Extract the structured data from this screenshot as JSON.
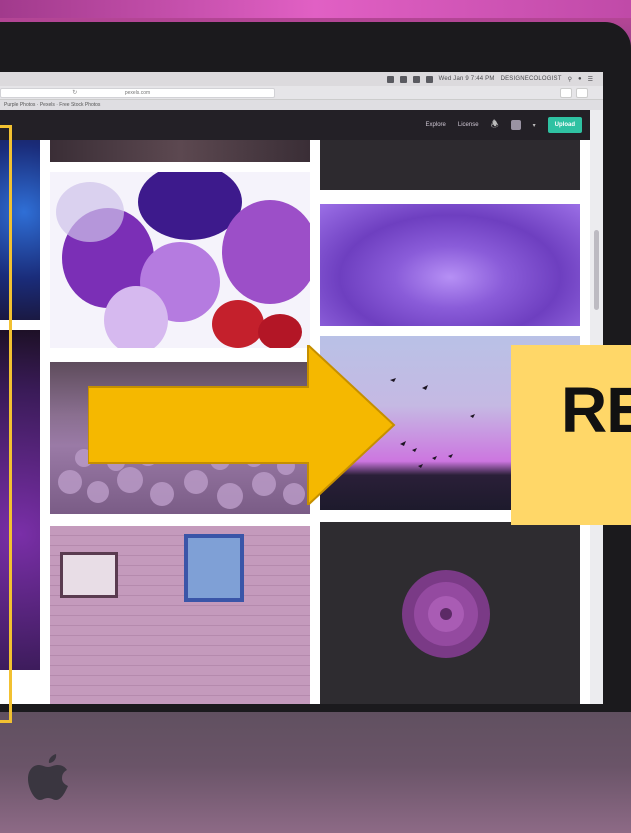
{
  "menubar": {
    "clock": "Wed Jan 9 7:44 PM",
    "user": "DESIGNECOLOGIST"
  },
  "browser": {
    "url": "pexels.com",
    "tab_title": "Purple Photos · Pexels · Free Stock Photos"
  },
  "site_header": {
    "nav_explore": "Explore",
    "nav_license": "License",
    "upload_label": "Upload"
  },
  "overlay": {
    "card_text": "RE"
  },
  "colors": {
    "upload": "#2fc1a2",
    "arrow": "#f5b800",
    "card": "#ffd768",
    "frame": "#f2c131"
  },
  "icons": {
    "bell": "bell-icon",
    "reload": "reload-icon",
    "apple": "apple-logo-icon"
  }
}
